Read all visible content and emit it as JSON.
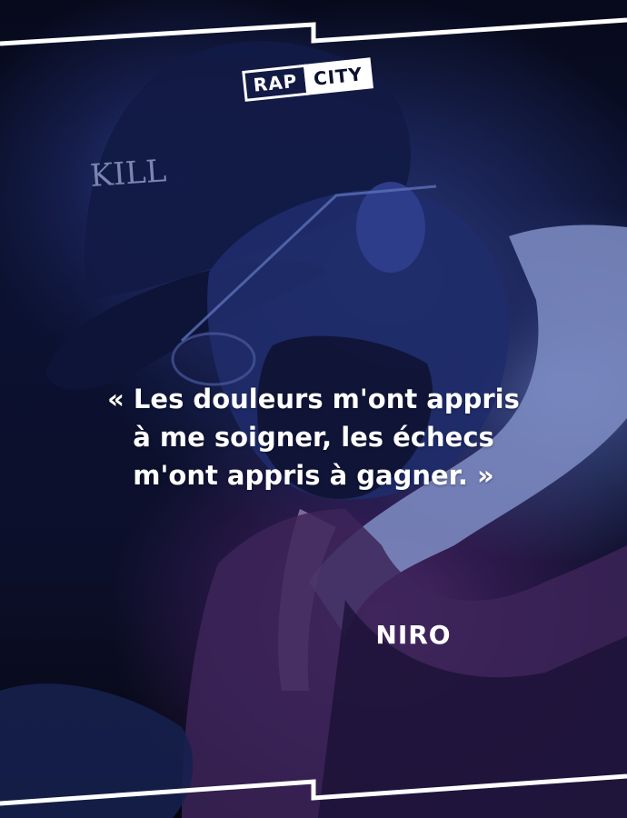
{
  "brand": {
    "logo_left": "RAP",
    "logo_right": "CITY"
  },
  "quote": {
    "text": "« Les douleurs m'ont appris\nà me soigner, les échecs\nm'ont appris à gagner. »"
  },
  "author": {
    "name": "NIRO"
  },
  "background": {
    "cap_text": "KILL"
  },
  "colors": {
    "text": "#ffffff",
    "background_dark": "#0b1130"
  }
}
